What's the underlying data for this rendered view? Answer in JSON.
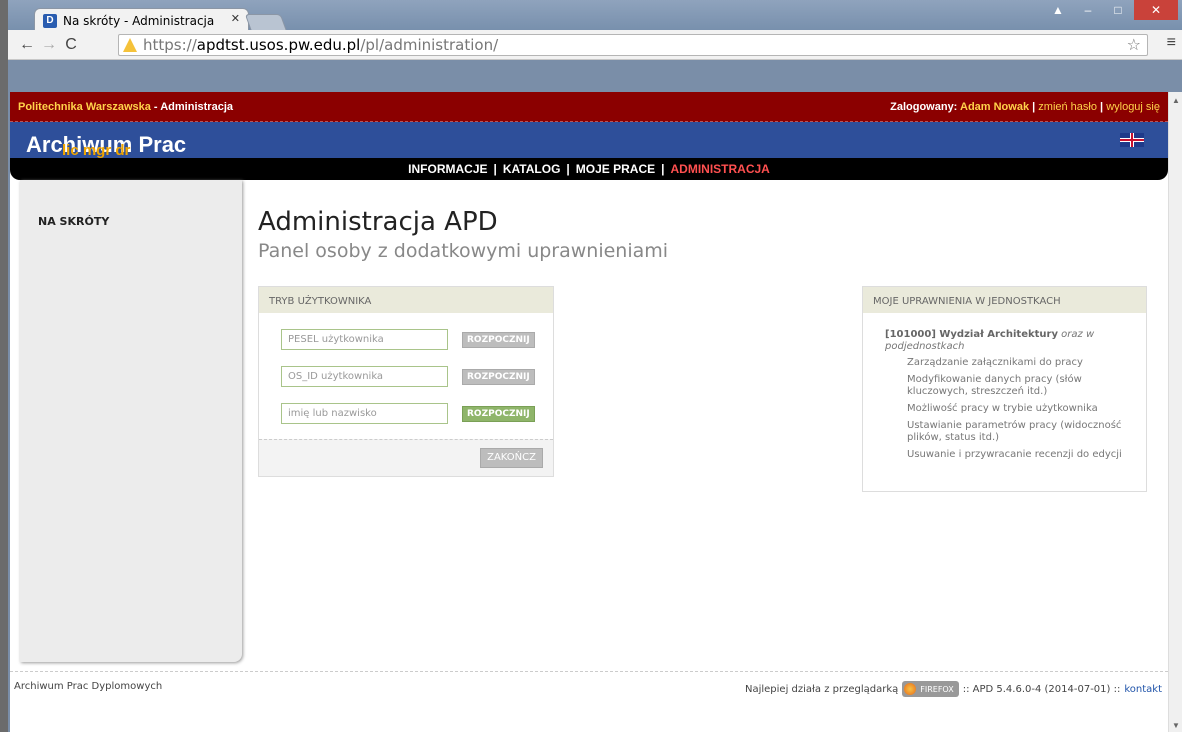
{
  "browser": {
    "tab_title": "Na skróty - Administracja",
    "tab_favicon": "D",
    "url_proto": "https://",
    "url_host": "apdtst.usos.pw.edu.pl",
    "url_path": "/pl/administration/"
  },
  "topbar": {
    "org": "Politechnika Warszawska",
    "section": " - Administracja",
    "logged_label": "Zalogowany: ",
    "user": "Adam Nowak",
    "change_password": "zmień hasło",
    "logout": "wyloguj się"
  },
  "banner": {
    "title": "Archiwum Prac",
    "subtitle": "lic mgr dr"
  },
  "nav": {
    "items": [
      "INFORMACJE",
      "KATALOG",
      "MOJE PRACE",
      "ADMINISTRACJA"
    ],
    "active": "ADMINISTRACJA"
  },
  "sidebar": {
    "items": [
      {
        "label": "NA SKRÓTY"
      }
    ]
  },
  "main": {
    "title": "Administracja APD",
    "subtitle": "Panel osoby z dodatkowymi uprawnieniami"
  },
  "user_mode": {
    "header": "TRYB UŻYTKOWNIKA",
    "fields": [
      {
        "placeholder": "PESEL użytkownika",
        "button": "ROZPOCZNIJ"
      },
      {
        "placeholder": "OS_ID użytkownika",
        "button": "ROZPOCZNIJ"
      },
      {
        "placeholder": "imię lub nazwisko",
        "button": "ROZPOCZNIJ"
      }
    ],
    "end_button": "ZAKOŃCZ"
  },
  "permissions": {
    "header": "MOJE UPRAWNIENIA W JEDNOSTKACH",
    "unit_name": "[101000] Wydział Architektury",
    "unit_suffix": "oraz w podjednostkach",
    "items": [
      "Zarządzanie załącznikami do pracy",
      "Modyfikowanie danych pracy (słów kluczowych, streszczeń itd.)",
      "Możliwość pracy w trybie użytkownika",
      "Ustawianie parametrów pracy (widoczność plików, status itd.)",
      "Usuwanie i przywracanie recenzji do edycji"
    ]
  },
  "footer": {
    "left": "Archiwum Prac Dyplomowych",
    "best_with": "Najlepiej działa z przeglądarką",
    "browser_badge": "FIREFOX",
    "version": ":: APD 5.4.6.0-4 (2014-07-01) ::",
    "contact": "kontakt"
  }
}
